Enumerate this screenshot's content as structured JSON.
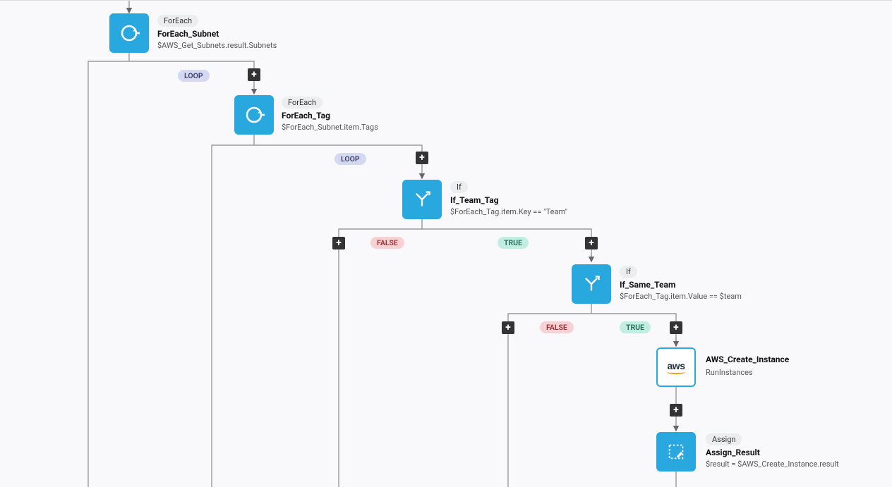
{
  "nodes": {
    "foreach_subnet": {
      "type": "ForEach",
      "title": "ForEach_Subnet",
      "subtitle": "$AWS_Get_Subnets.result.Subnets"
    },
    "foreach_tag": {
      "type": "ForEach",
      "title": "ForEach_Tag",
      "subtitle": "$ForEach_Subnet.item.Tags"
    },
    "if_team_tag": {
      "type": "If",
      "title": "If_Team_Tag",
      "subtitle": "$ForEach_Tag.item.Key == \"Team\""
    },
    "if_same_team": {
      "type": "If",
      "title": "If_Same_Team",
      "subtitle": "$ForEach_Tag.item.Value == $team"
    },
    "aws_create": {
      "title": "AWS_Create_Instance",
      "subtitle": "RunInstances"
    },
    "assign_result": {
      "type": "Assign",
      "title": "Assign_Result",
      "subtitle": "$result = $AWS_Create_Instance.result"
    }
  },
  "badges": {
    "loop": "LOOP",
    "true": "TRUE",
    "false": "FALSE"
  },
  "colors": {
    "node_blue": "#29a8e0",
    "loop_badge": "#d4d8f0",
    "true_badge": "#c2ede1",
    "false_badge": "#f7d2d4"
  }
}
